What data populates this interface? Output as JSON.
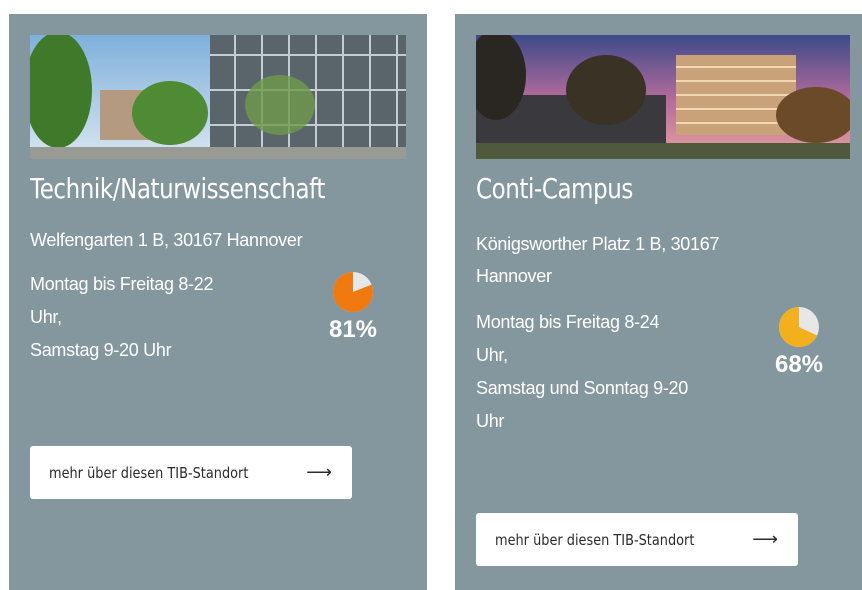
{
  "cards": [
    {
      "title": "Technik/Naturwissenschaft",
      "address_lines": [
        "Welfengarten 1 B, 30167 Hannover"
      ],
      "hours_lines": [
        "Montag bis Freitag 8-22",
        "Uhr,",
        "Samstag 9-20 Uhr"
      ],
      "occupancy_percent": 81,
      "occupancy_label": "81%",
      "occupancy_color": "#f07a10",
      "button_label": "mehr über diesen TIB-Standort",
      "arrow_icon": "arrow-right-icon"
    },
    {
      "title": "Conti-Campus",
      "address_lines": [
        "Königsworther Platz 1 B, 30167",
        "Hannover"
      ],
      "hours_lines": [
        "Montag bis Freitag 8-24",
        "Uhr,",
        "Samstag und Sonntag 9-20",
        "Uhr"
      ],
      "occupancy_percent": 68,
      "occupancy_label": "68%",
      "occupancy_color": "#f2b01e",
      "button_label": "mehr über diesen TIB-Standort",
      "arrow_icon": "arrow-right-icon"
    }
  ],
  "colors": {
    "card_background": "#84979f",
    "pie_remainder": "#e7e7e7"
  }
}
